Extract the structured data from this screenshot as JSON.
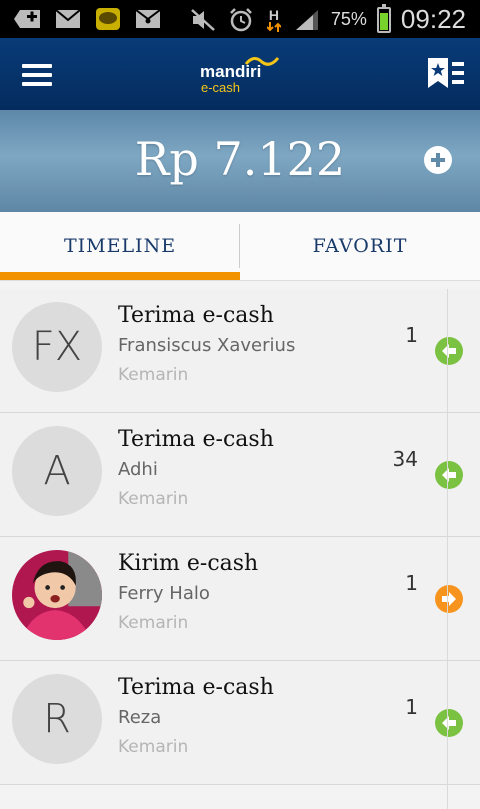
{
  "status_bar": {
    "battery_percent": "75%",
    "time": "09:22",
    "network": "H",
    "icons": [
      "add-icon",
      "mail-icon",
      "kakaotalk-icon",
      "message-icon",
      "mute-icon",
      "alarm-icon",
      "network-icon",
      "signal-icon",
      "battery-icon"
    ],
    "battery_color": "#79d22b"
  },
  "app_bar": {
    "brand": "mandiri",
    "product": "e-cash",
    "colors": {
      "bar": "#093b78",
      "logo_accent": "#f5c518"
    }
  },
  "balance": {
    "text": "Rp 7.122"
  },
  "tabs": [
    {
      "label": "TIMELINE",
      "active": true
    },
    {
      "label": "FAVORIT",
      "active": false
    }
  ],
  "accent_color": "#f39200",
  "transactions": [
    {
      "initials": "FX",
      "title": "Terima e-cash",
      "name": "Fransiscus Xaverius",
      "time": "Kemarin",
      "amount": "1",
      "direction": "in"
    },
    {
      "initials": "A",
      "title": "Terima e-cash",
      "name": "Adhi",
      "time": "Kemarin",
      "amount": "34",
      "direction": "in"
    },
    {
      "initials": "",
      "title": "Kirim e-cash",
      "name": "Ferry Halo",
      "time": "Kemarin",
      "amount": "1",
      "direction": "out",
      "has_photo": true
    },
    {
      "initials": "R",
      "title": "Terima e-cash",
      "name": "Reza",
      "time": "Kemarin",
      "amount": "1",
      "direction": "in"
    }
  ]
}
